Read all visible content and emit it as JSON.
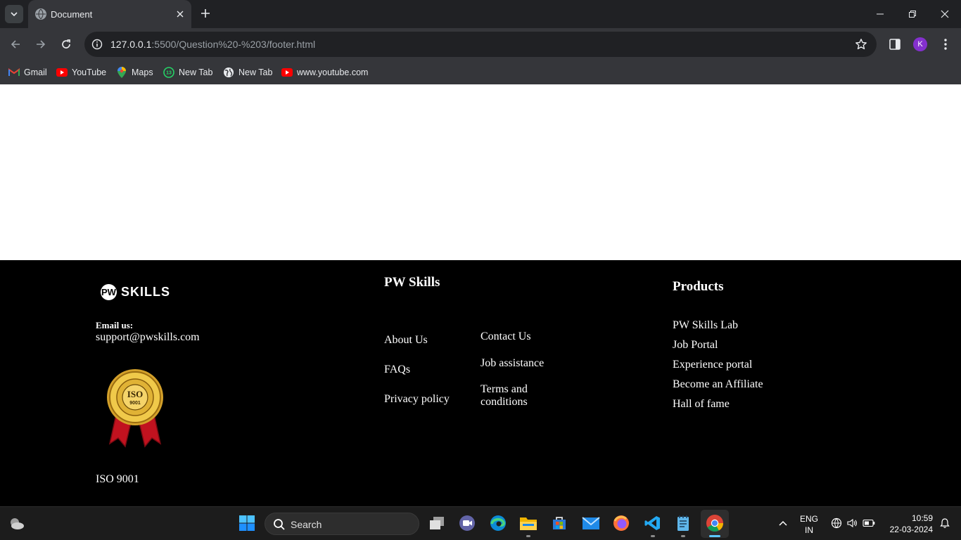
{
  "browser": {
    "tab_title": "Document",
    "url_host": "127.0.0.1",
    "url_rest": ":5500/Question%20-%203/footer.html",
    "profile_initial": "K",
    "bookmarks": [
      {
        "label": "Gmail",
        "icon": "gmail-icon"
      },
      {
        "label": "YouTube",
        "icon": "youtube-icon"
      },
      {
        "label": "Maps",
        "icon": "maps-icon"
      },
      {
        "label": "New Tab",
        "icon": "whatsapp-icon",
        "badge": "13"
      },
      {
        "label": "New Tab",
        "icon": "globe-icon"
      },
      {
        "label": "www.youtube.com",
        "icon": "youtube-icon"
      }
    ]
  },
  "footer": {
    "logo_text": "SKILLS",
    "email_label": "Email us:",
    "email_value": "support@pwskills.com",
    "iso_seal_text": "ISO",
    "iso_seal_number": "9001",
    "iso_caption": "ISO 9001",
    "pw_title": "PW Skills",
    "pw_links_col1": [
      "About Us",
      "FAQs",
      "Privacy policy"
    ],
    "pw_links_col2": [
      "Contact Us",
      "Job assistance",
      "Terms and conditions"
    ],
    "products_title": "Products",
    "products_links": [
      "PW Skills Lab",
      "Job Portal",
      "Experience portal",
      "Become an Affiliate",
      "Hall of fame"
    ]
  },
  "taskbar": {
    "search_label": "Search",
    "language": "ENG",
    "region": "IN",
    "time": "10:59",
    "date": "22-03-2024"
  },
  "colors": {
    "footer_bg": "#000000",
    "chrome_bg": "#35363a",
    "taskbar_bg": "#1c1c1c"
  }
}
